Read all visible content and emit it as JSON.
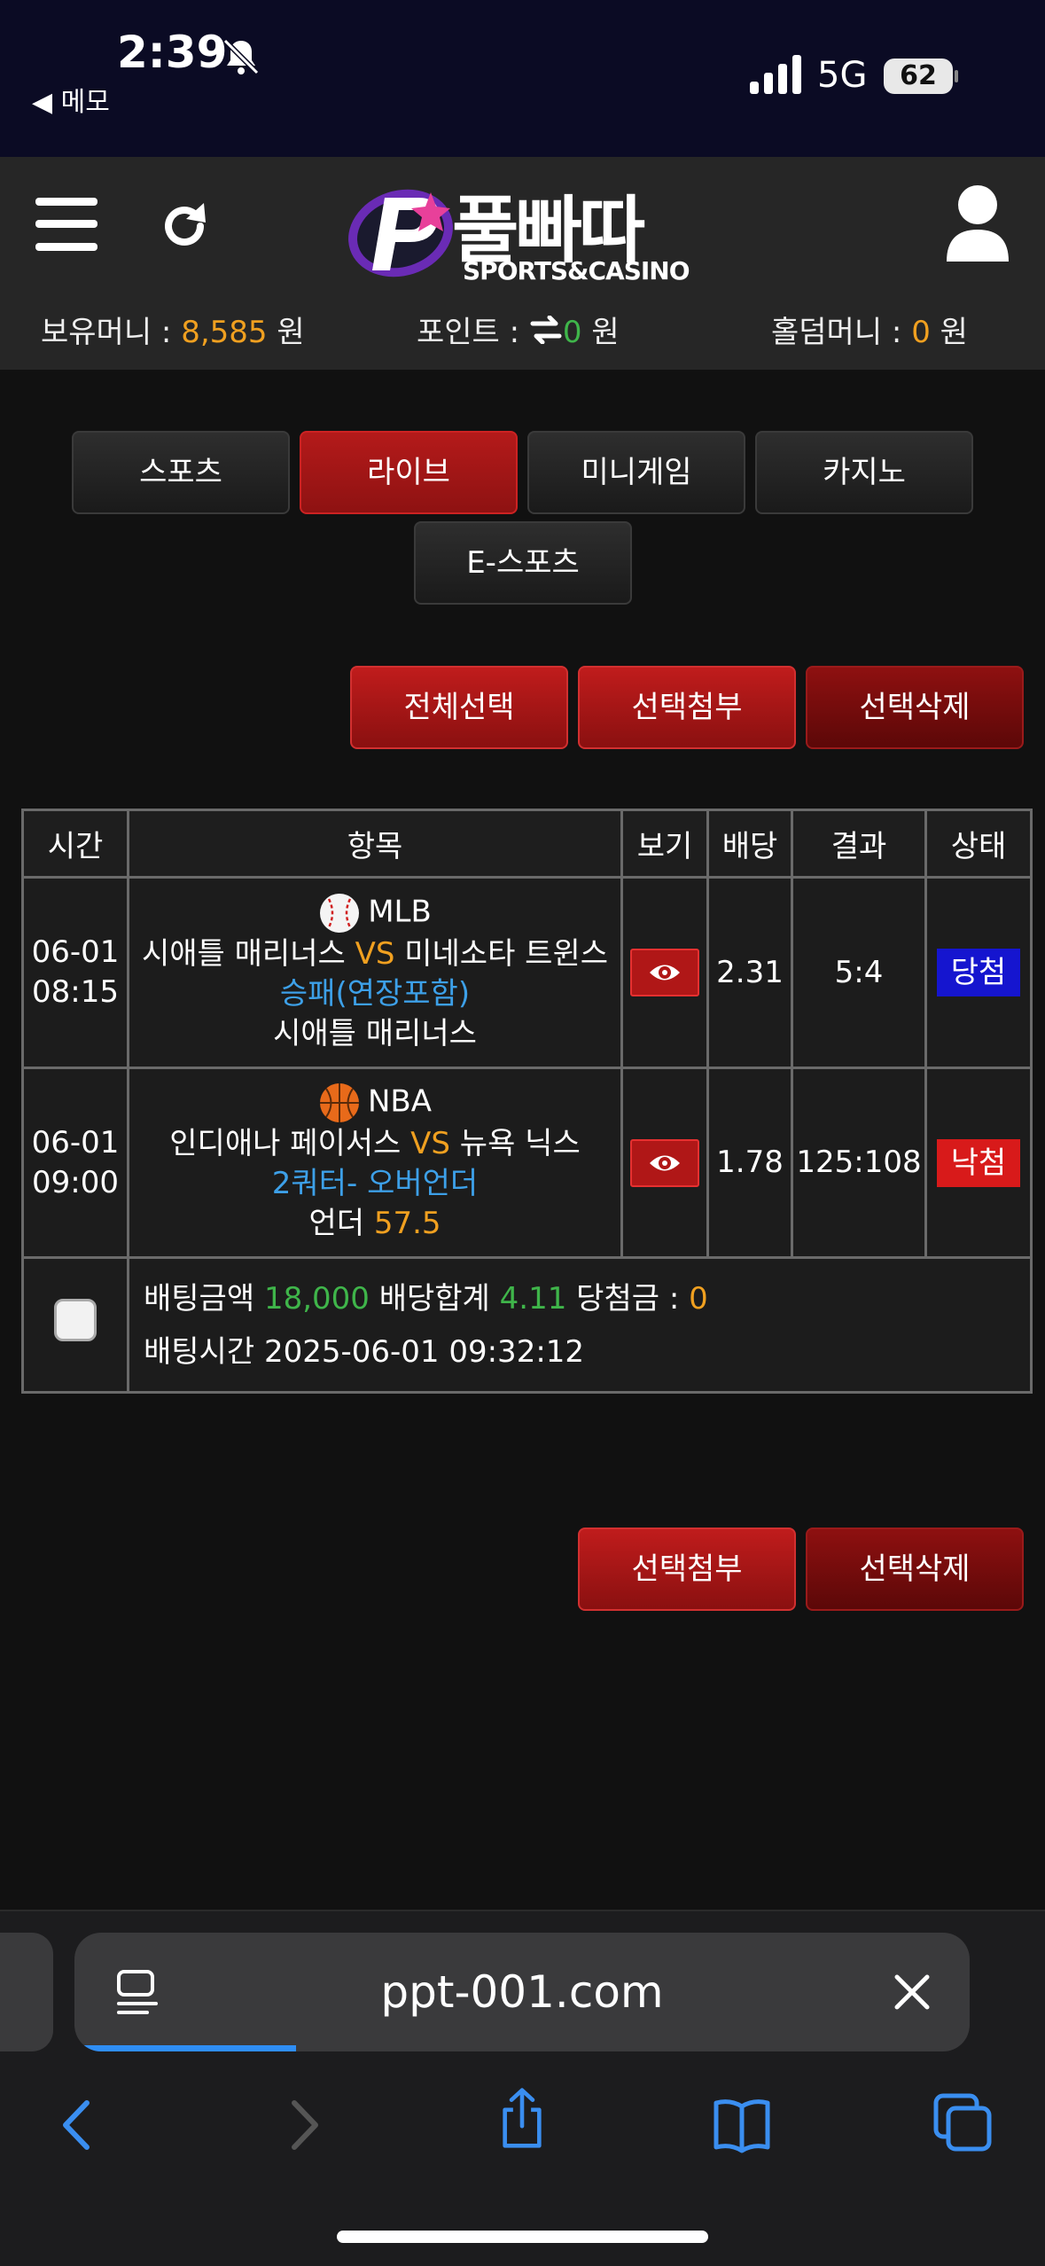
{
  "status": {
    "time": "2:39",
    "back_app": "◀ 메모",
    "network": "5G",
    "battery": "62"
  },
  "header": {
    "logo_name": "풀빠따",
    "logo_sub": "SPORTS&CASINO",
    "balance_label": "보유머니 : ",
    "balance_value": "8,585",
    "balance_unit": " 원",
    "points_label": "포인트 : ",
    "points_value": "0",
    "points_unit": " 원",
    "holdem_label": "홀덤머니 : ",
    "holdem_value": "0",
    "holdem_unit": " 원"
  },
  "tabs": [
    "스포츠",
    "라이브",
    "미니게임",
    "카지노",
    "E-스포츠"
  ],
  "actions_top": {
    "select_all": "전체선택",
    "attach": "선택첨부",
    "delete": "선택삭제"
  },
  "actions_bottom": {
    "attach": "선택첨부",
    "delete": "선택삭제"
  },
  "table": {
    "headers": [
      "시간",
      "항목",
      "보기",
      "배당",
      "결과",
      "상태"
    ],
    "rows": [
      {
        "date": "06-01",
        "time": "08:15",
        "league": "MLB",
        "home": "시애틀 매리너스",
        "vs": "VS",
        "away": "미네소타 트윈스",
        "market": "승패(연장포함)",
        "pick": "시애틀 매리너스",
        "pick_value": "",
        "odds": "2.31",
        "result": "5:4",
        "status": "당첨"
      },
      {
        "date": "06-01",
        "time": "09:00",
        "league": "NBA",
        "home": "인디애나 페이서스",
        "vs": "VS",
        "away": "뉴욕 닉스",
        "market": "2쿼터- 오버언더",
        "pick": "언더 ",
        "pick_value": "57.5",
        "odds": "1.78",
        "result": "125:108",
        "status": "낙첨"
      }
    ],
    "summary": {
      "amount_label": "배팅금액 ",
      "amount_value": "18,000",
      "odds_label": " 배당합계 ",
      "odds_value": "4.11",
      "win_label": " 당첨금 : ",
      "win_value": "0",
      "time_label": "배팅시간 ",
      "time_value": "2025-06-01 09:32:12"
    }
  },
  "browser": {
    "url": "ppt-001.com"
  },
  "colors": {
    "accent_red": "#b41a1a",
    "orange": "#f0a020",
    "green": "#3fb54a",
    "blue": "#3da0e8",
    "win_badge": "#1515cf",
    "lose_badge": "#d81a1a"
  }
}
